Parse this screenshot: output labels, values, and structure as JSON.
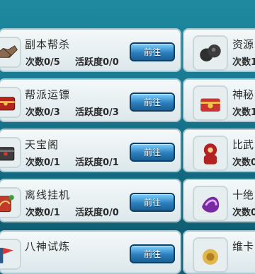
{
  "left_rows": [
    {
      "title": "副本帮杀",
      "count": "次数0/5",
      "activity": "活跃度0/0",
      "button": "前往",
      "icon": "handshake-icon"
    },
    {
      "title": "帮派运镖",
      "count": "次数0/3",
      "activity": "活跃度0/3",
      "button": "前往",
      "icon": "treasure-chest-icon"
    },
    {
      "title": "天宝阁",
      "count": "次数0/1",
      "activity": "活跃度0/1",
      "button": "前往",
      "icon": "black-chest-icon"
    },
    {
      "title": "离线挂机",
      "count": "次数0/1",
      "activity": "活跃度0/0",
      "button": "前往",
      "icon": "leaf-sign-icon"
    },
    {
      "title": "八神试炼",
      "button": "前往",
      "icon": "flag-icon"
    }
  ],
  "right_rows": [
    {
      "title": "资源",
      "count": "次数1",
      "icon": "black-ore-icon"
    },
    {
      "title": "神秘",
      "count": "次数1",
      "icon": "red-chest-icon"
    },
    {
      "title": "比武",
      "count": "次数0",
      "icon": "red-warrior-icon"
    },
    {
      "title": "十绝",
      "count": "次数0",
      "icon": "purple-gem-icon"
    },
    {
      "title": "维卡",
      "icon": "gold-coin-icon"
    }
  ]
}
